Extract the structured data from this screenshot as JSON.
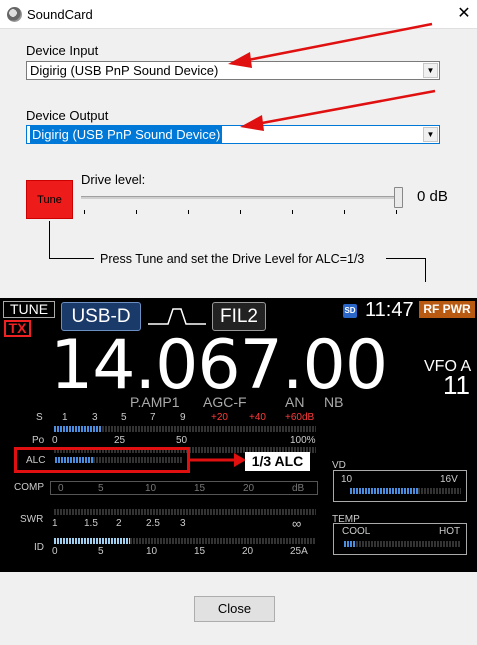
{
  "window": {
    "title": "SoundCard",
    "close_glyph": "✕"
  },
  "device_input": {
    "label": "Device Input",
    "value": "Digirig (USB PnP Sound Device)"
  },
  "device_output": {
    "label": "Device Output",
    "value": "Digirig (USB PnP Sound Device)"
  },
  "tune_button": {
    "label": "Tune",
    "color": "#ee1b1b"
  },
  "drive_level": {
    "label": "Drive level:",
    "value_text": "0 dB",
    "level_fraction": 1.0
  },
  "note": "Press Tune and set the Drive Level for ALC=1/3",
  "annotation_arrow_color": "#e01010",
  "radio": {
    "tune_tag": "TUNE",
    "tx_tag": "TX",
    "mode": "USB-D",
    "filter": "FIL2",
    "sd_badge": "SD",
    "time": "11:47",
    "rf_pwr": "RF PWR",
    "frequency": "14.067.00",
    "vfo": "VFO A",
    "vfo_num": "11",
    "pamp": "P.AMP1",
    "agc": "AGC-F",
    "an": "AN",
    "nb": "NB",
    "s_meter": {
      "name": "S",
      "ticks": [
        "1",
        "3",
        "5",
        "7",
        "9"
      ],
      "red_ticks": [
        "+20",
        "+40",
        "+60dB"
      ]
    },
    "po_meter": {
      "name": "Po",
      "ticks": [
        "0",
        "25",
        "50",
        "100%"
      ]
    },
    "alc_meter": {
      "name": "ALC"
    },
    "alc_callout": "1/3 ALC",
    "comp_meter": {
      "name": "COMP",
      "ticks": [
        "0",
        "5",
        "10",
        "15",
        "20",
        "dB"
      ]
    },
    "swr_meter": {
      "name": "SWR",
      "ticks": [
        "1",
        "1.5",
        "2",
        "2.5",
        "3",
        "∞"
      ]
    },
    "id_meter": {
      "name": "ID",
      "ticks": [
        "0",
        "5",
        "10",
        "15",
        "20",
        "25A"
      ]
    },
    "vd_meter": {
      "name": "VD",
      "ticks": [
        "10",
        "16V"
      ]
    },
    "temp_meter": {
      "name": "TEMP",
      "ticks": [
        "COOL",
        "HOT"
      ]
    },
    "accent_blue": "#4a8ee0",
    "rf_pwr_color": "#b85a12"
  },
  "close_button": {
    "label": "Close"
  }
}
